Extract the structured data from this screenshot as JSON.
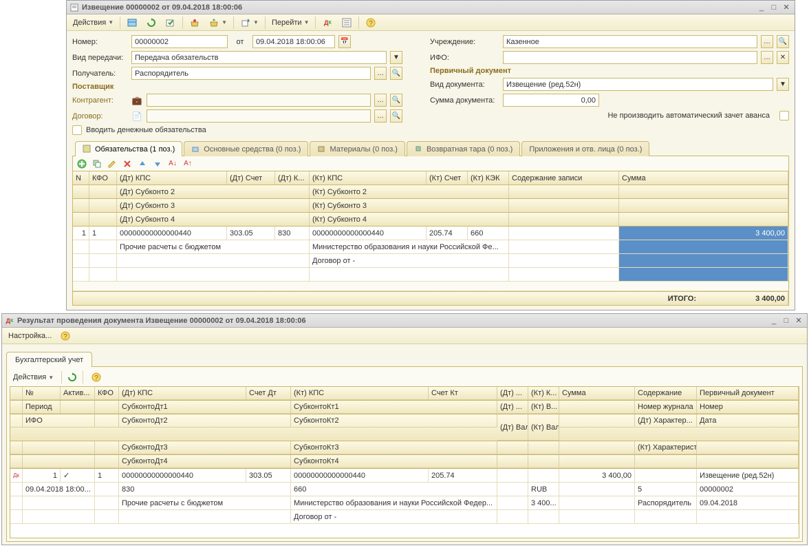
{
  "window1": {
    "title": "Извещение 00000002 от 09.04.2018 18:00:06",
    "actions_label": "Действия",
    "goto_label": "Перейти",
    "form": {
      "number_label": "Номер:",
      "number_value": "00000002",
      "from_label": "от",
      "date_value": "09.04.2018 18:00:06",
      "transfer_type_label": "Вид передачи:",
      "transfer_type_value": "Передача обязательств",
      "recipient_label": "Получатель:",
      "recipient_value": "Распорядитель",
      "supplier_title": "Поставщик",
      "counterparty_label": "Контрагент:",
      "counterparty_value": "",
      "contract_label": "Договор:",
      "contract_value": "",
      "institution_label": "Учреждение:",
      "institution_value": "Казенное",
      "ifo_label": "ИФО:",
      "ifo_value": "",
      "primary_doc_title": "Первичный документ",
      "doc_type_label": "Вид документа:",
      "doc_type_value": "Извещение (ред.52н)",
      "doc_sum_label": "Сумма документа:",
      "doc_sum_value": "0,00",
      "no_auto_offset": "Не производить автоматический зачет аванса",
      "enter_money_label": "Вводить денежные обязательства"
    },
    "tabs": [
      {
        "label": "Обязательства (1 поз.)"
      },
      {
        "label": "Основные средства (0 поз.)"
      },
      {
        "label": "Материалы (0 поз.)"
      },
      {
        "label": "Возвратная тара (0 поз.)"
      },
      {
        "label": "Приложения и отв. лица (0 поз.)"
      }
    ],
    "grid": {
      "headers": [
        "N",
        "КФО",
        "(Дт) КПС",
        "(Дт) Счет",
        "(Дт) К...",
        "(Кт) КПС",
        "(Кт) Счет",
        "(Кт) КЭК",
        "Содержание записи",
        "Сумма"
      ],
      "sub1": [
        "(Дт) Субконто 2",
        "(Кт) Субконто 2"
      ],
      "sub2": [
        "(Дт) Субконто 3",
        "(Кт) Субконто 3"
      ],
      "sub3": [
        "(Дт) Субконто 4",
        "(Кт) Субконто 4"
      ],
      "row": {
        "n": "1",
        "kfo": "1",
        "dt_kps": "00000000000000440",
        "dt_acct": "303.05",
        "dt_k": "830",
        "kt_kps": "00000000000000440",
        "kt_acct": "205.74",
        "kt_kek": "660",
        "content": "",
        "sum": "3 400,00",
        "dt_sub2": "Прочие расчеты с бюджетом",
        "kt_sub2": "Министерство образования и науки Российской Фе...",
        "kt_sub3": "Договор  от -"
      },
      "footer_label": "ИТОГО:",
      "footer_sum": "3 400,00"
    }
  },
  "window2": {
    "title": "Результат проведения документа Извещение 00000002 от 09.04.2018 18:00:06",
    "settings_label": "Настройка...",
    "tab_label": "Бухгалтерский учет",
    "actions_label": "Действия",
    "grid": {
      "h1": [
        "№",
        "Актив...",
        "КФО",
        "(Дт) КПС",
        "Счет Дт",
        "(Кт) КПС",
        "Счет Кт",
        "(Дт) ...",
        "(Кт) К...",
        "Сумма",
        "Содержание",
        "Первичный документ"
      ],
      "h2": [
        "Период",
        "",
        "",
        "СубконтоДт1",
        "",
        "СубконтоКт1",
        "",
        "(Дт) ...",
        "(Кт) В...",
        "",
        "Номер журнала",
        "Номер"
      ],
      "h3": [
        "ИФО",
        "",
        "",
        "СубконтоДт2",
        "",
        "СубконтоКт2",
        "",
        "(Дт) Вал. сумма",
        "(Кт) Вал. сумма",
        "",
        "(Дт) Характер...",
        "Дата"
      ],
      "h4": [
        "",
        "",
        "",
        "СубконтоДт3",
        "",
        "СубконтоКт3",
        "",
        "",
        "",
        "",
        "(Кт) Характеристи...",
        ""
      ],
      "h5": [
        "",
        "",
        "",
        "СубконтоДт4",
        "",
        "СубконтоКт4",
        "",
        "",
        "",
        "",
        "",
        ""
      ],
      "row": {
        "n": "1",
        "active_check": "✓",
        "kfo": "1",
        "dt_kps": "00000000000000440",
        "dt_acct": "303.05",
        "kt_kps": "00000000000000440",
        "kt_acct": "205.74",
        "sum": "3 400,00",
        "primary": "Извещение (ред.52н)",
        "period": "09.04.2018 18:00...",
        "dt_sub1": "830",
        "kt_sub1": "660",
        "kt_val": "RUB",
        "journal": "5",
        "number": "00000002",
        "dt_sub2": "Прочие расчеты с бюджетом",
        "kt_sub2": "Министерство образования и науки Российской Федер...",
        "kt_sum2": "3 400...",
        "recipient": "Распорядитель",
        "date": "09.04.2018",
        "kt_sub3": "Договор  от -"
      }
    }
  }
}
